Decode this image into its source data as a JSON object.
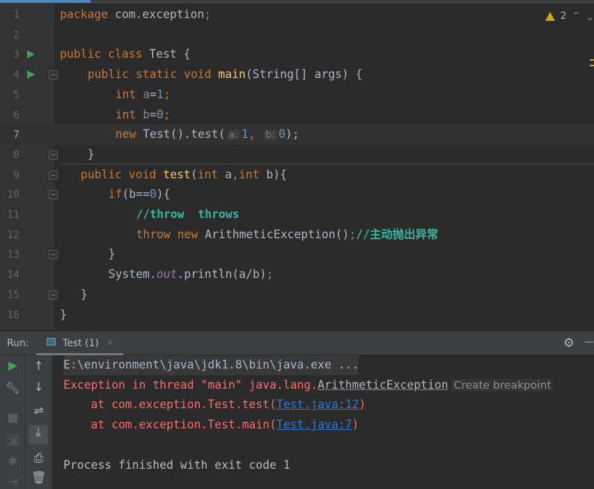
{
  "editor": {
    "warnings_count": "2",
    "current_line": 7,
    "lines": [
      {
        "n": "1",
        "indent": 0,
        "segs": [
          [
            "package ",
            "kw"
          ],
          [
            "com.exception",
            "plain"
          ],
          [
            ";",
            "kw"
          ]
        ]
      },
      {
        "n": "2",
        "indent": 0,
        "segs": []
      },
      {
        "n": "3",
        "indent": 0,
        "run": true,
        "segs": [
          [
            "public class ",
            "kw"
          ],
          [
            "Test {",
            "plain"
          ]
        ]
      },
      {
        "n": "4",
        "indent": 4,
        "run": true,
        "fold": true,
        "segs": [
          [
            "public static void ",
            "kw"
          ],
          [
            "main",
            "fn"
          ],
          [
            "(String[] args) {",
            "plain"
          ]
        ]
      },
      {
        "n": "5",
        "indent": 8,
        "segs": [
          [
            "int ",
            "kw"
          ],
          [
            "a",
            "var"
          ],
          [
            "=",
            "plain"
          ],
          [
            "1",
            "num"
          ],
          [
            ";",
            "kw"
          ]
        ]
      },
      {
        "n": "6",
        "indent": 8,
        "segs": [
          [
            "int ",
            "kw"
          ],
          [
            "b",
            "var"
          ],
          [
            "=",
            "plain"
          ],
          [
            "0",
            "num"
          ],
          [
            ";",
            "kw"
          ]
        ]
      },
      {
        "n": "7",
        "indent": 8,
        "segs": [
          [
            "new ",
            "kw"
          ],
          [
            "Test().test(",
            "plain"
          ],
          [
            "a:",
            "hint"
          ],
          [
            "1",
            "num"
          ],
          [
            ", ",
            "kw"
          ],
          [
            "b:",
            "hint"
          ],
          [
            "0",
            "num"
          ],
          [
            ");",
            "plain"
          ]
        ]
      },
      {
        "n": "8",
        "indent": 4,
        "fold": true,
        "segs": [
          [
            "}",
            "plain"
          ]
        ]
      },
      {
        "n": "9",
        "indent": 3,
        "fold": true,
        "segs": [
          [
            "public void ",
            "kw"
          ],
          [
            "test",
            "fn"
          ],
          [
            "(",
            "plain"
          ],
          [
            "int ",
            "kw"
          ],
          [
            "a",
            "plain"
          ],
          [
            ",",
            "kw"
          ],
          [
            "int ",
            "kw"
          ],
          [
            "b){",
            "plain"
          ]
        ]
      },
      {
        "n": "10",
        "indent": 7,
        "fold": true,
        "segs": [
          [
            "if",
            "kw"
          ],
          [
            "(b==",
            "plain"
          ],
          [
            "0",
            "num"
          ],
          [
            "){",
            "plain"
          ]
        ]
      },
      {
        "n": "11",
        "indent": 11,
        "segs": [
          [
            "//throw  throws",
            "cm"
          ]
        ]
      },
      {
        "n": "12",
        "indent": 11,
        "segs": [
          [
            "throw new ",
            "kw"
          ],
          [
            "ArithmeticException()",
            "plain"
          ],
          [
            ";",
            "kw"
          ],
          [
            "//主动抛出异常",
            "cm"
          ]
        ]
      },
      {
        "n": "13",
        "indent": 7,
        "fold": true,
        "segs": [
          [
            "}",
            "plain"
          ]
        ]
      },
      {
        "n": "14",
        "indent": 7,
        "segs": [
          [
            "System.",
            "plain"
          ],
          [
            "out",
            "st"
          ],
          [
            ".println(a/b)",
            "plain"
          ],
          [
            ";",
            "kw"
          ]
        ]
      },
      {
        "n": "15",
        "indent": 3,
        "fold": true,
        "segs": [
          [
            "}",
            "plain"
          ]
        ]
      },
      {
        "n": "16",
        "indent": 0,
        "segs": [
          [
            "}",
            "plain"
          ]
        ]
      }
    ]
  },
  "run_panel": {
    "label": "Run:",
    "tab_label": "Test (1)",
    "close_glyph": "×",
    "console": {
      "command": "E:\\environment\\java\\jdk1.8\\bin\\java.exe ...",
      "exception_prefix": "Exception in thread \"main\" java.lang.",
      "exception_class": "ArithmeticException",
      "create_breakpoint": "Create breakpoint",
      "trace": [
        {
          "prefix": "    at com.exception.Test.test(",
          "link": "Test.java:12",
          "suffix": ")"
        },
        {
          "prefix": "    at com.exception.Test.main(",
          "link": "Test.java:7",
          "suffix": ")"
        }
      ],
      "finished": "Process finished with exit code 1"
    }
  }
}
